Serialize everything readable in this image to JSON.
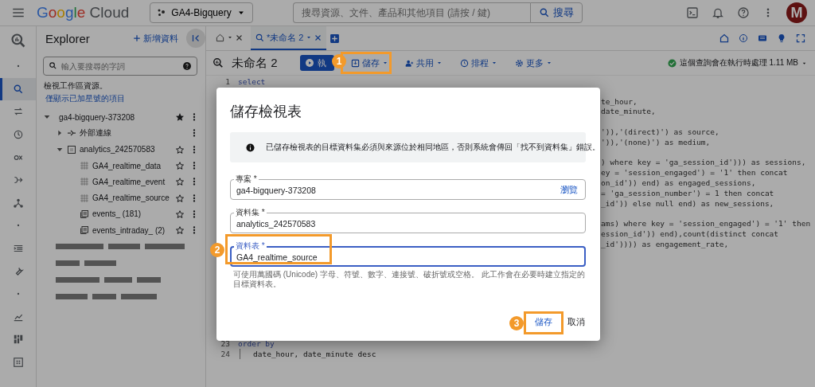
{
  "topbar": {
    "logo": "Google Cloud",
    "project": "GA4-Bigquery",
    "search": {
      "placeholder": "搜尋資源、文件、產品和其他項目 (請按 / 鍵)",
      "button": "搜尋"
    },
    "avatar": "M"
  },
  "explorer": {
    "title": "Explorer",
    "add_button": "新增資料",
    "search": {
      "placeholder": "輸入要搜尋的字詞"
    },
    "note": "檢視工作區資源。",
    "starred_link": "僅顯示已加星號的項目",
    "tree": [
      {
        "label": "ga4-bigquery-373208",
        "kind": "project",
        "expanded": true,
        "starred": true,
        "children": [
          {
            "label": "外部連線",
            "kind": "connection",
            "expanded": false
          },
          {
            "label": "analytics_242570583",
            "kind": "dataset",
            "expanded": true,
            "starred": false,
            "children": [
              {
                "label": "GA4_realtime_data",
                "kind": "view",
                "starred": false
              },
              {
                "label": "GA4_realtime_event",
                "kind": "view",
                "starred": false
              },
              {
                "label": "GA4_realtime_source",
                "kind": "view",
                "starred": false
              },
              {
                "label": "events_ (181)",
                "kind": "table",
                "starred": false
              },
              {
                "label": "events_intraday_ (2)",
                "kind": "table",
                "starred": false
              }
            ]
          }
        ]
      }
    ]
  },
  "editor": {
    "tabs": [
      {
        "kind": "home",
        "selected": false
      },
      {
        "kind": "query",
        "label": "*未命名 2",
        "selected": true
      }
    ],
    "title": "未命名 2",
    "run_button": "執",
    "save_button": "儲存",
    "share_button": "共用",
    "schedule_button": "排程",
    "more_button": "更多",
    "status": "這個查詢會在執行時處理 1.11 MB",
    "first_lines": [
      {
        "number": "1",
        "text": "select"
      }
    ],
    "partial_line_groups": [
      [
        "te_hour,",
        "date_minute,"
      ],
      [
        "')),'(direct)') as source,",
        "')),'(none)') as medium,"
      ],
      [
        ") where key = 'ga_session_id'))) as sessions,",
        "ey = 'session_engaged') = '1' then concat",
        "on_id')) end) as engaged_sessions,",
        "= 'ga_session_number') = 1 then concat",
        "_id')) else null end) as new_sessions,"
      ],
      [
        "ams) where key = 'session_engaged') = '1' then",
        "ession_id')) end),count(distinct concat",
        "_id')))) as engagement_rate,"
      ]
    ],
    "last_lines": [
      {
        "number": "23",
        "text": "order by",
        "indented": false
      },
      {
        "number": "24",
        "text": "date_hour, date_minute desc",
        "indented": true
      }
    ]
  },
  "dialog": {
    "title": "儲存檢視表",
    "notice": "已儲存檢視表的目標資料集必須與來源位於相同地區，否則系統會傳回「找不到資料集」錯誤。",
    "fields": [
      {
        "label": "專案 *",
        "value": "ga4-bigquery-373208",
        "action": "瀏覽",
        "focused": false
      },
      {
        "label": "資料集 *",
        "value": "analytics_242570583",
        "focused": false
      },
      {
        "label": "資料表 *",
        "value": "GA4_realtime_source",
        "focused": true
      }
    ],
    "hint": "可使用萬國碼 (Unicode) 字母、符號、數字、連接號、破折號或空格。 此工作會在必要時建立指定的目標資料表。",
    "buttons": [
      {
        "label": "儲存",
        "kind": "primary"
      },
      {
        "label": "取消",
        "kind": "secondary"
      }
    ]
  },
  "annotations": [
    {
      "number": "1"
    },
    {
      "number": "2"
    },
    {
      "number": "3"
    }
  ]
}
